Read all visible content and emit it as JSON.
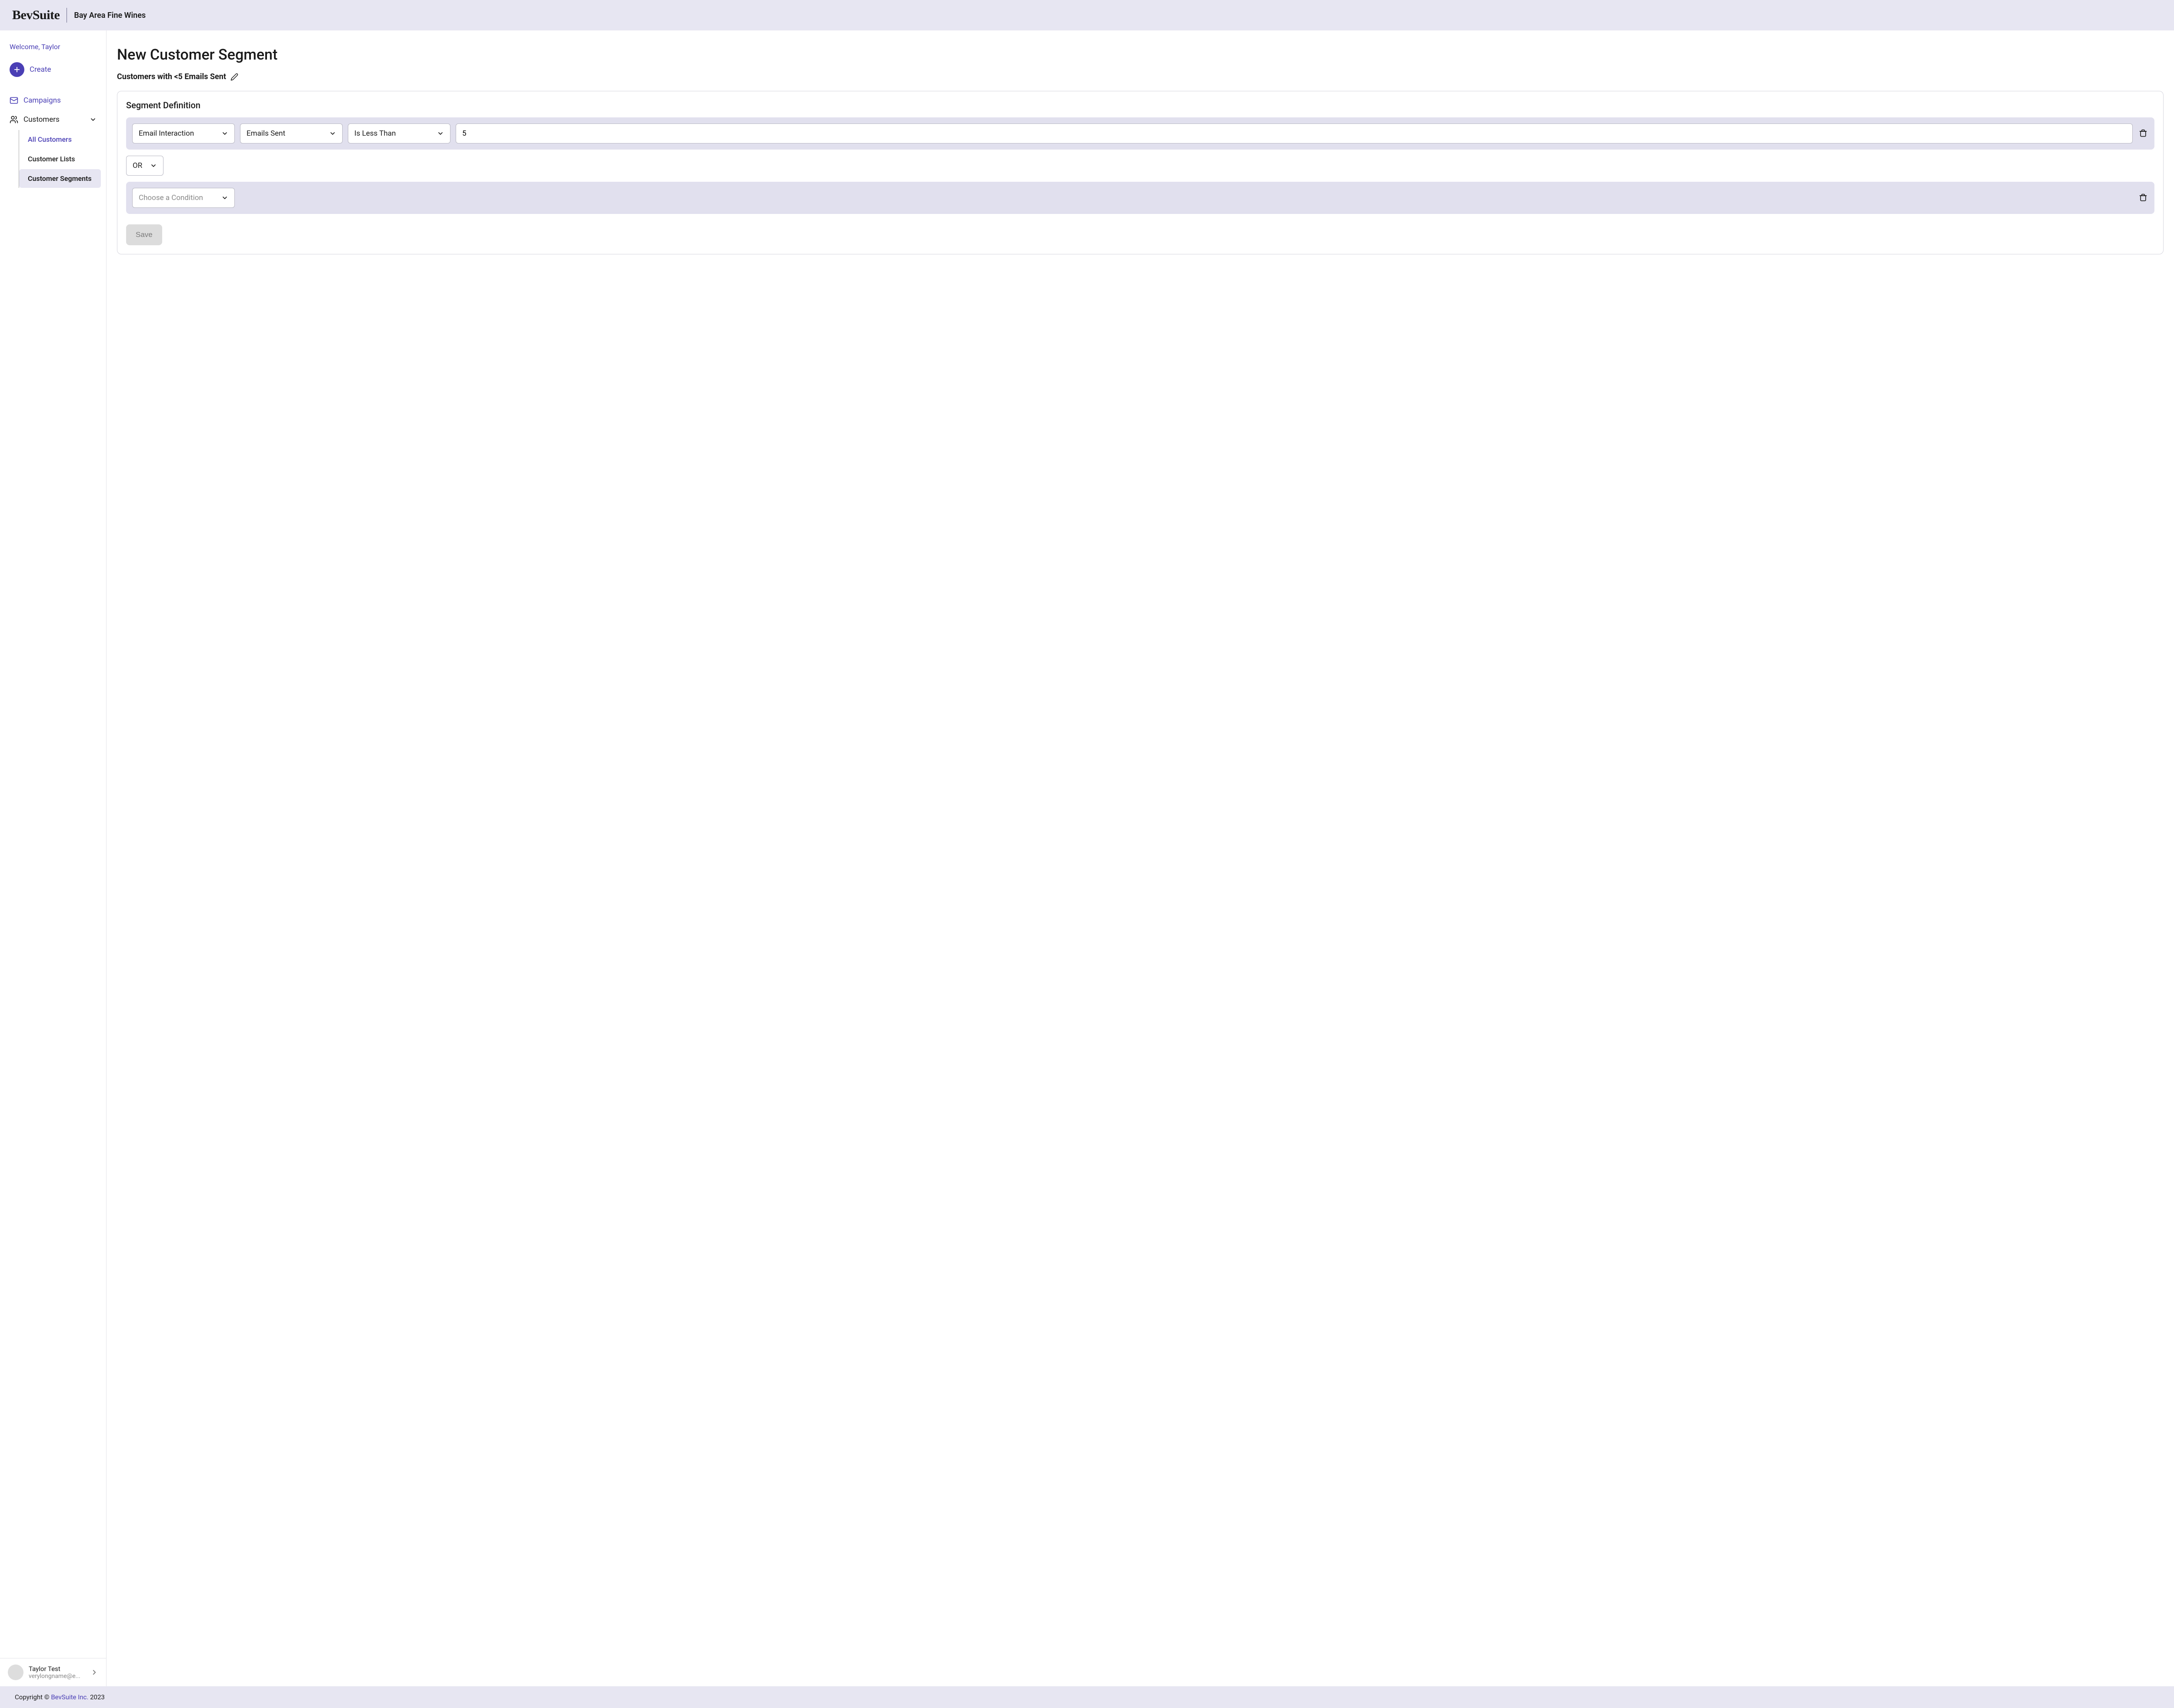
{
  "header": {
    "logo": "BevSuite",
    "tenant": "Bay Area Fine Wines"
  },
  "sidebar": {
    "welcome": "Welcome, Taylor",
    "create_label": "Create",
    "nav": {
      "campaigns": "Campaigns",
      "customers": "Customers"
    },
    "subnav": {
      "all_customers": "All Customers",
      "customer_lists": "Customer Lists",
      "customer_segments": "Customer Segments"
    },
    "user": {
      "name": "Taylor Test",
      "email": "verylongname@e..."
    }
  },
  "main": {
    "page_title": "New Customer Segment",
    "segment_name": "Customers with <5 Emails Sent",
    "card_title": "Segment Definition",
    "condition1": {
      "category": "Email Interaction",
      "field": "Emails Sent",
      "operator": "Is Less Than",
      "value": "5"
    },
    "logic_operator": "OR",
    "condition2": {
      "placeholder": "Choose a Condition"
    },
    "save_label": "Save"
  },
  "footer": {
    "prefix": "Copyright © ",
    "brand": "BevSuite Inc.",
    "suffix": " 2023"
  }
}
